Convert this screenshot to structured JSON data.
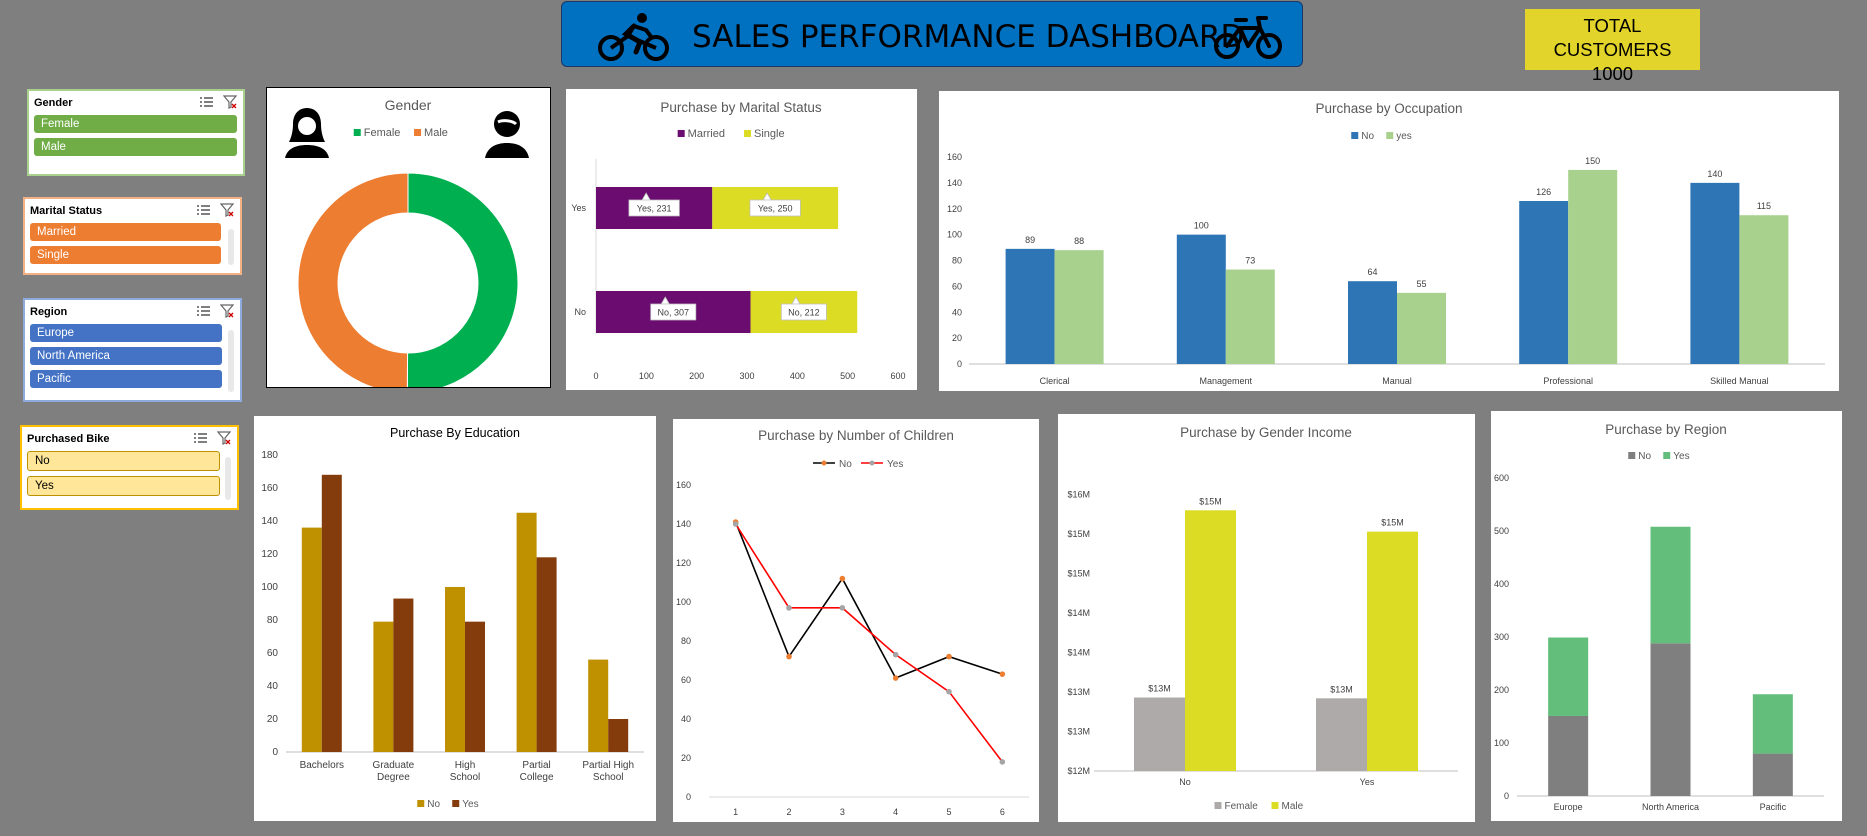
{
  "header": {
    "title": "SALES PERFORMANCE DASHBOARD",
    "bike_icon": "bicycle-icon",
    "cyclist_icon": "cyclist-icon"
  },
  "kpi": {
    "label": "TOTAL CUSTOMERS",
    "value": "1000"
  },
  "slicers": {
    "gender": {
      "title": "Gender",
      "items": [
        "Female",
        "Male"
      ],
      "color": "#70ad47",
      "border": "#a9d18e"
    },
    "marital": {
      "title": "Marital Status",
      "items": [
        "Married",
        "Single"
      ],
      "color": "#ed7d31",
      "border": "#f4b183"
    },
    "region": {
      "title": "Region",
      "items": [
        "Europe",
        "North America",
        "Pacific"
      ],
      "color": "#4472c4",
      "border": "#8faadc"
    },
    "bike": {
      "title": "Purchased Bike",
      "items": [
        "No",
        "Yes"
      ],
      "color": "#ffe699",
      "border": "#ffc000"
    }
  },
  "icons": {
    "multiselect": "multi-select-icon",
    "clear_filter": "clear-filter-icon",
    "female": "female-avatar-icon",
    "male": "male-avatar-icon"
  },
  "chart_data": [
    {
      "id": "gender",
      "type": "pie",
      "title": "Gender",
      "categories": [
        "Female",
        "Male"
      ],
      "values": [
        50.1,
        49.9
      ],
      "colors": [
        "#00b050",
        "#ed7d31"
      ],
      "legend": "top"
    },
    {
      "id": "marital",
      "type": "bar",
      "title": "Purchase by Marital Status",
      "orientation": "horizontal",
      "stacked": true,
      "categories": [
        "No",
        "Yes"
      ],
      "series": [
        {
          "name": "Married",
          "values": [
            307,
            231
          ],
          "color": "#6a0c70"
        },
        {
          "name": "Single",
          "values": [
            212,
            250
          ],
          "color": "#dcdc25"
        }
      ],
      "data_labels": {
        "Married": [
          "No, 307",
          "Yes, 231"
        ],
        "Single": [
          "No, 212",
          "Yes, 250"
        ]
      },
      "xlim": [
        0,
        600
      ],
      "xticks": [
        0,
        100,
        200,
        300,
        400,
        500,
        600
      ],
      "legend": "top"
    },
    {
      "id": "occupation",
      "type": "bar",
      "title": "Purchase by Occupation",
      "categories": [
        "Clerical",
        "Management",
        "Manual",
        "Professional",
        "Skilled Manual"
      ],
      "series": [
        {
          "name": "No",
          "values": [
            89,
            100,
            64,
            126,
            140
          ],
          "color": "#2e75b6"
        },
        {
          "name": "yes",
          "values": [
            88,
            73,
            55,
            150,
            115
          ],
          "color": "#a9d18e"
        }
      ],
      "ylim": [
        0,
        160
      ],
      "yticks": [
        0,
        20,
        40,
        60,
        80,
        100,
        120,
        140,
        160
      ],
      "legend": "top"
    },
    {
      "id": "education",
      "type": "bar",
      "title": "Purchase By Education",
      "categories": [
        "Bachelors",
        "Graduate Degree",
        "High School",
        "Partial College",
        "Partial High School"
      ],
      "series": [
        {
          "name": "No",
          "values": [
            136,
            79,
            100,
            145,
            56
          ],
          "color": "#bf9000"
        },
        {
          "name": "Yes",
          "values": [
            168,
            93,
            79,
            118,
            20
          ],
          "color": "#843c0c"
        }
      ],
      "ylim": [
        0,
        180
      ],
      "yticks": [
        0,
        20,
        40,
        60,
        80,
        100,
        120,
        140,
        160,
        180
      ],
      "legend": "bottom"
    },
    {
      "id": "children",
      "type": "line",
      "title": "Purchase by Number of Children",
      "x": [
        1,
        2,
        3,
        4,
        5,
        6
      ],
      "series": [
        {
          "name": "No",
          "values": [
            141,
            72,
            112,
            61,
            72,
            63
          ],
          "color": "#000000",
          "marker": "#ed7d31"
        },
        {
          "name": "Yes",
          "values": [
            140,
            97,
            97,
            73,
            54,
            18
          ],
          "color": "#ff0000",
          "marker": "#a5a5a5"
        }
      ],
      "ylim": [
        0,
        160
      ],
      "yticks": [
        0,
        20,
        40,
        60,
        80,
        100,
        120,
        140,
        160
      ],
      "legend": "top"
    },
    {
      "id": "income",
      "type": "bar",
      "title": "Purchase by Gender Income",
      "categories": [
        "No",
        "Yes"
      ],
      "series": [
        {
          "name": "Female",
          "values": [
            12.93,
            12.92
          ],
          "color": "#aeaaaa"
        },
        {
          "name": "Male",
          "values": [
            15.3,
            15.03
          ],
          "color": "#dcdc25"
        }
      ],
      "data_labels": {
        "Female": [
          "$13M",
          "$13M"
        ],
        "Male": [
          "$15M",
          "$15M"
        ]
      },
      "ylim": [
        12,
        16
      ],
      "yticks": [
        12,
        12.5,
        13,
        13.5,
        14,
        14.5,
        15,
        15.5,
        16
      ],
      "ytick_labels": [
        "$12M",
        "$13M",
        "$13M",
        "$14M",
        "$14M",
        "$15M",
        "$15M",
        "$16M"
      ],
      "legend": "bottom"
    },
    {
      "id": "region",
      "type": "bar",
      "title": "Purchase by Region",
      "stacked": true,
      "categories": [
        "Europe",
        "North America",
        "Pacific"
      ],
      "series": [
        {
          "name": "No",
          "values": [
            151,
            288,
            80
          ],
          "color": "#7f7f7f"
        },
        {
          "name": "Yes",
          "values": [
            148,
            220,
            112
          ],
          "color": "#63be7b"
        }
      ],
      "ylim": [
        0,
        600
      ],
      "yticks": [
        0,
        100,
        200,
        300,
        400,
        500,
        600
      ],
      "legend": "top"
    }
  ]
}
